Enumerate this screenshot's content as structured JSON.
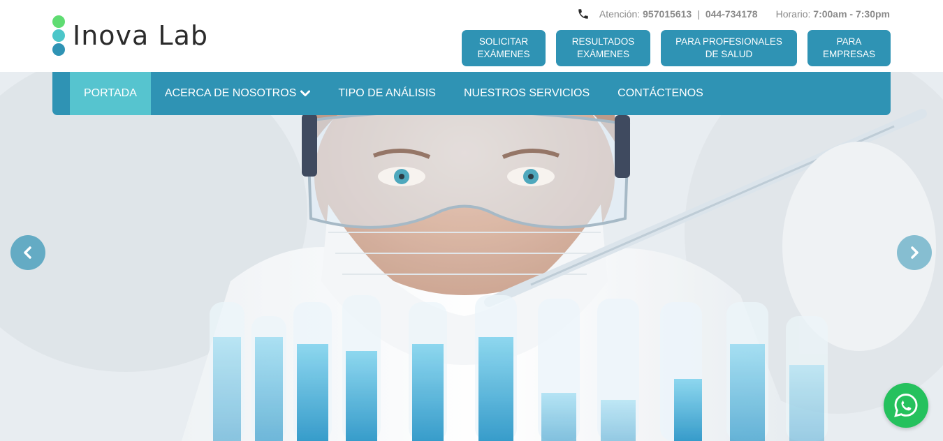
{
  "brand": {
    "name": "Inova Lab"
  },
  "contact": {
    "attention_label": "Atención:",
    "phone_1": "957015613",
    "separator": "|",
    "phone_2": "044-734178",
    "hours_label": "Horario:",
    "hours_value": "7:00am - 7:30pm"
  },
  "top_buttons": [
    {
      "line1": "SOLICITAR",
      "line2": "EXÁMENES"
    },
    {
      "line1": "RESULTADOS",
      "line2": "EXÁMENES"
    },
    {
      "line1": "PARA PROFESIONALES",
      "line2": "DE SALUD"
    },
    {
      "line1": "PARA",
      "line2": "EMPRESAS"
    }
  ],
  "nav": {
    "items": [
      {
        "label": "PORTADA",
        "active": true
      },
      {
        "label": "ACERCA DE NOSOTROS",
        "has_dropdown": true
      },
      {
        "label": "TIPO DE ANÁLISIS"
      },
      {
        "label": "NUESTROS SERVICIOS"
      },
      {
        "label": "CONTÁCTENOS"
      }
    ]
  },
  "hero": {
    "image": "scientist-with-test-tubes",
    "prev_icon": "chevron-left-icon",
    "next_icon": "chevron-right-icon"
  },
  "floating": {
    "icon": "whatsapp-icon"
  },
  "colors": {
    "primary": "#2f93b4",
    "nav_active": "#56c4cf",
    "logo_green": "#5fdc72",
    "logo_teal": "#4cc6c9",
    "logo_blue": "#2f93b4",
    "whatsapp": "#25c15d"
  }
}
